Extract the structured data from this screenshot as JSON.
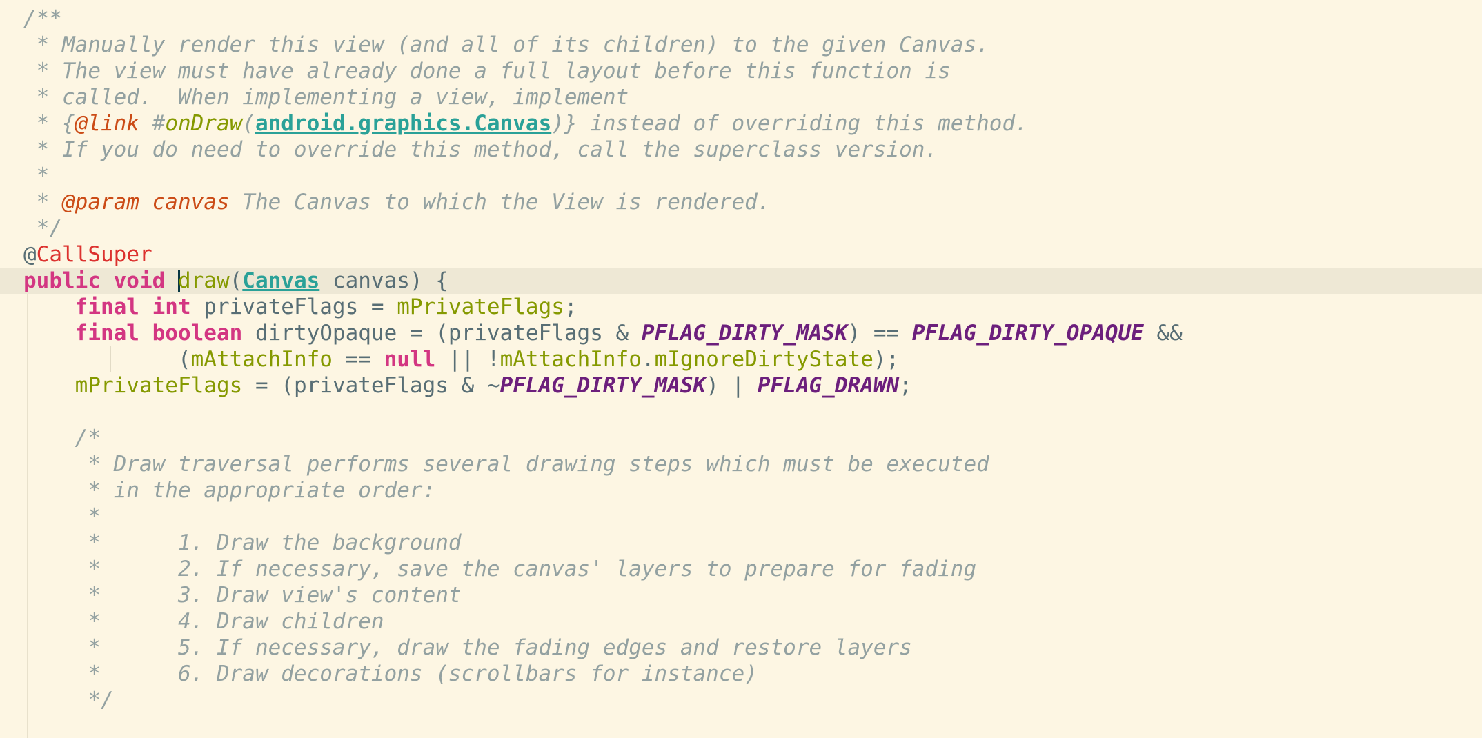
{
  "editor": {
    "caret_line": 11,
    "colors": {
      "background": "#fdf6e3",
      "current_line": "#eee8d5",
      "comment": "#93a1a1",
      "keyword": "#d33682",
      "annotation": "#dc322f",
      "javadoc_tag": "#cb4b16",
      "javadoc_link": "#2aa198",
      "method": "#859900",
      "constant": "#6c1f7c",
      "text": "#586e75"
    },
    "lines": [
      [
        {
          "c": "cmt",
          "t": "/**"
        }
      ],
      [
        {
          "c": "cmt",
          "t": " * Manually render this view (and all of its children) to the given Canvas."
        }
      ],
      [
        {
          "c": "cmt",
          "t": " * The view must have already done a full layout before this function is"
        }
      ],
      [
        {
          "c": "cmt",
          "t": " * called.  When implementing a view, implement"
        }
      ],
      [
        {
          "c": "cmt",
          "t": " * {"
        },
        {
          "c": "jd-tag",
          "t": "@link"
        },
        {
          "c": "cmt",
          "t": " #"
        },
        {
          "c": "jd-meth",
          "t": "onDraw"
        },
        {
          "c": "cmt",
          "t": "("
        },
        {
          "c": "jd-ref",
          "t": "android.graphics.Canvas"
        },
        {
          "c": "cmt",
          "t": ")} instead of overriding this method."
        }
      ],
      [
        {
          "c": "cmt",
          "t": " * If you do need to override this method, call the superclass version."
        }
      ],
      [
        {
          "c": "cmt",
          "t": " *"
        }
      ],
      [
        {
          "c": "cmt",
          "t": " * "
        },
        {
          "c": "jd-tag",
          "t": "@param canvas"
        },
        {
          "c": "cmt",
          "t": " The Canvas to which the View is rendered."
        }
      ],
      [
        {
          "c": "cmt",
          "t": " */"
        }
      ],
      [
        {
          "c": "anno-at",
          "t": "@"
        },
        {
          "c": "anno",
          "t": "CallSuper"
        }
      ],
      [
        {
          "c": "kw",
          "t": "public void "
        },
        {
          "c": "caret",
          "t": ""
        },
        {
          "c": "fn",
          "t": "draw"
        },
        {
          "c": "plain",
          "t": "("
        },
        {
          "c": "type-link",
          "t": "Canvas"
        },
        {
          "c": "plain",
          "t": " canvas) {"
        }
      ],
      [
        {
          "c": "plain",
          "t": "    "
        },
        {
          "c": "kw",
          "t": "final int "
        },
        {
          "c": "plain",
          "t": "privateFlags = "
        },
        {
          "c": "field",
          "t": "mPrivateFlags"
        },
        {
          "c": "plain",
          "t": ";"
        }
      ],
      [
        {
          "c": "plain",
          "t": "    "
        },
        {
          "c": "kw",
          "t": "final boolean "
        },
        {
          "c": "plain",
          "t": "dirtyOpaque = (privateFlags & "
        },
        {
          "c": "const",
          "t": "PFLAG_DIRTY_MASK"
        },
        {
          "c": "plain",
          "t": ") == "
        },
        {
          "c": "const",
          "t": "PFLAG_DIRTY_OPAQUE"
        },
        {
          "c": "plain",
          "t": " &&"
        }
      ],
      [
        {
          "c": "plain",
          "t": "            ("
        },
        {
          "c": "field",
          "t": "mAttachInfo"
        },
        {
          "c": "plain",
          "t": " == "
        },
        {
          "c": "kw",
          "t": "null"
        },
        {
          "c": "plain",
          "t": " || !"
        },
        {
          "c": "field",
          "t": "mAttachInfo"
        },
        {
          "c": "plain",
          "t": "."
        },
        {
          "c": "field",
          "t": "mIgnoreDirtyState"
        },
        {
          "c": "plain",
          "t": ");"
        }
      ],
      [
        {
          "c": "plain",
          "t": "    "
        },
        {
          "c": "field",
          "t": "mPrivateFlags"
        },
        {
          "c": "plain",
          "t": " = (privateFlags & ~"
        },
        {
          "c": "const",
          "t": "PFLAG_DIRTY_MASK"
        },
        {
          "c": "plain",
          "t": ") | "
        },
        {
          "c": "const",
          "t": "PFLAG_DRAWN"
        },
        {
          "c": "plain",
          "t": ";"
        }
      ],
      [],
      [
        {
          "c": "cmt",
          "t": "    /*"
        }
      ],
      [
        {
          "c": "cmt",
          "t": "     * Draw traversal performs several drawing steps which must be executed"
        }
      ],
      [
        {
          "c": "cmt",
          "t": "     * in the appropriate order:"
        }
      ],
      [
        {
          "c": "cmt",
          "t": "     *"
        }
      ],
      [
        {
          "c": "cmt",
          "t": "     *      1. Draw the background"
        }
      ],
      [
        {
          "c": "cmt",
          "t": "     *      2. If necessary, save the canvas' layers to prepare for fading"
        }
      ],
      [
        {
          "c": "cmt",
          "t": "     *      3. Draw view's content"
        }
      ],
      [
        {
          "c": "cmt",
          "t": "     *      4. Draw children"
        }
      ],
      [
        {
          "c": "cmt",
          "t": "     *      5. If necessary, draw the fading edges and restore layers"
        }
      ],
      [
        {
          "c": "cmt",
          "t": "     *      6. Draw decorations (scrollbars for instance)"
        }
      ],
      [
        {
          "c": "cmt",
          "t": "     */"
        }
      ]
    ]
  }
}
